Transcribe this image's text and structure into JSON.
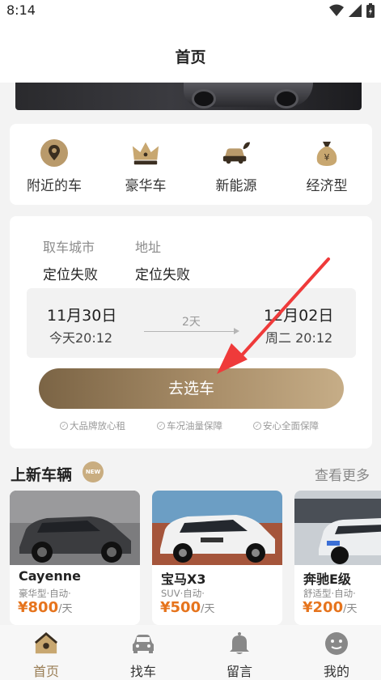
{
  "status": {
    "time": "8:14"
  },
  "header": {
    "title": "首页"
  },
  "categories": [
    {
      "label": "附近的车",
      "icon": "location-pin-icon"
    },
    {
      "label": "豪华车",
      "icon": "crown-icon"
    },
    {
      "label": "新能源",
      "icon": "eco-car-icon"
    },
    {
      "label": "经济型",
      "icon": "money-bag-icon"
    }
  ],
  "booking": {
    "city_label": "取车城市",
    "city_value": "定位失败",
    "address_label": "地址",
    "address_value": "定位失败",
    "pickup_date": "11月30日",
    "pickup_time": "今天20:12",
    "duration": "2天",
    "return_date": "12月02日",
    "return_time": "周二 20:12",
    "submit_label": "去选车",
    "guarantees": [
      "大品牌放心租",
      "车况油量保障",
      "安心全面保障"
    ]
  },
  "new_cars": {
    "title": "上新车辆",
    "badge": "NEW",
    "more_label": "查看更多",
    "cars": [
      {
        "name": "Cayenne",
        "spec": "豪华型·自动·",
        "price": "¥800",
        "unit": "/天"
      },
      {
        "name": "宝马X3",
        "spec": "SUV·自动·",
        "price": "¥500",
        "unit": "/天"
      },
      {
        "name": "奔驰E级",
        "spec": "舒适型·自动·",
        "price": "¥200",
        "unit": "/天"
      }
    ]
  },
  "tabs": [
    {
      "label": "首页",
      "icon": "home-icon",
      "active": true
    },
    {
      "label": "找车",
      "icon": "car-icon",
      "active": false
    },
    {
      "label": "留言",
      "icon": "bell-icon",
      "active": false
    },
    {
      "label": "我的",
      "icon": "profile-icon",
      "active": false
    }
  ],
  "colors": {
    "accent": "#9a7e55",
    "price": "#e6741d",
    "button_start": "#7b6445",
    "button_end": "#c6ad87"
  }
}
